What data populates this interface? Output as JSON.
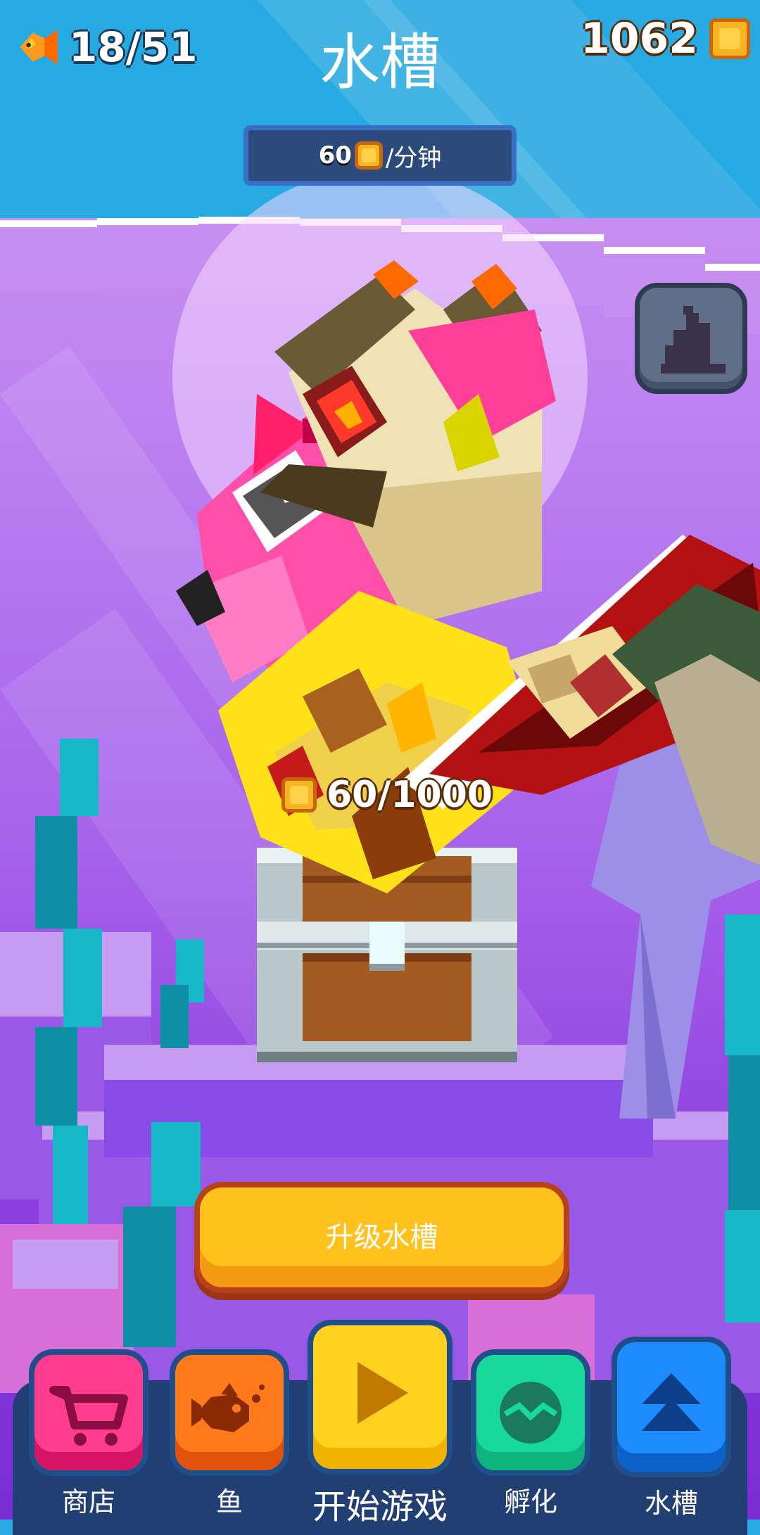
{
  "header": {
    "fish_count": "18/51",
    "title": "水槽",
    "coins": "1062"
  },
  "income": {
    "amount": "60",
    "unit": "/分钟"
  },
  "chest": {
    "progress_text": "60/1000",
    "progress": 0.06
  },
  "actions": {
    "upgrade_label": "升级水槽"
  },
  "nav": {
    "shop": "商店",
    "fish": "鱼",
    "play": "开始游戏",
    "hatch": "孵化",
    "tank": "水槽"
  },
  "colors": {
    "sky": "#27a9e1",
    "water": "#b679ef",
    "nav_bar": "#223f73",
    "shop": "#ff3d8e",
    "fish": "#ff7a1a",
    "play": "#ffd21f",
    "hatch": "#19d99a",
    "tank": "#1e8cff",
    "upgrade": "#ffc21c"
  },
  "icons": {
    "fish_count": "goldfish-icon",
    "coin": "coin-icon",
    "decor": "statue-icon",
    "shop": "cart-icon",
    "fish": "fish-icon",
    "play": "play-icon",
    "hatch": "egg-icon",
    "tank": "chevron-up-icon"
  }
}
